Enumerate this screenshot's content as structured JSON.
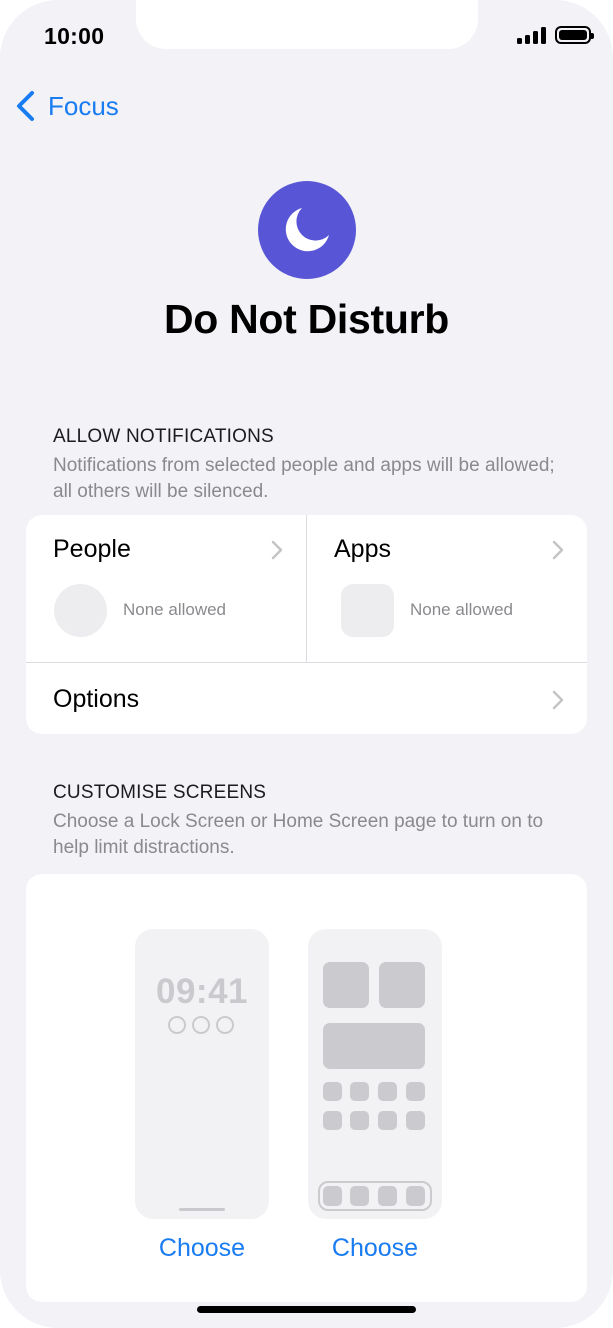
{
  "status_bar": {
    "time": "10:00"
  },
  "nav": {
    "back_label": "Focus"
  },
  "header": {
    "title": "Do Not Disturb",
    "accent_color": "#5856d6",
    "icon": "moon-icon"
  },
  "allow_notifications": {
    "header": "ALLOW NOTIFICATIONS",
    "description": "Notifications from selected people and apps will be allowed; all others will be silenced.",
    "people": {
      "label": "People",
      "status": "None allowed"
    },
    "apps": {
      "label": "Apps",
      "status": "None allowed"
    },
    "options": {
      "label": "Options"
    }
  },
  "customise_screens": {
    "header": "CUSTOMISE SCREENS",
    "description": "Choose a Lock Screen or Home Screen page to turn on to help limit distractions.",
    "lock_preview_time": "09:41",
    "lock_choose_label": "Choose",
    "home_choose_label": "Choose"
  },
  "colors": {
    "link": "#1a7cf1",
    "background": "#f2f2f7",
    "card": "#ffffff"
  }
}
